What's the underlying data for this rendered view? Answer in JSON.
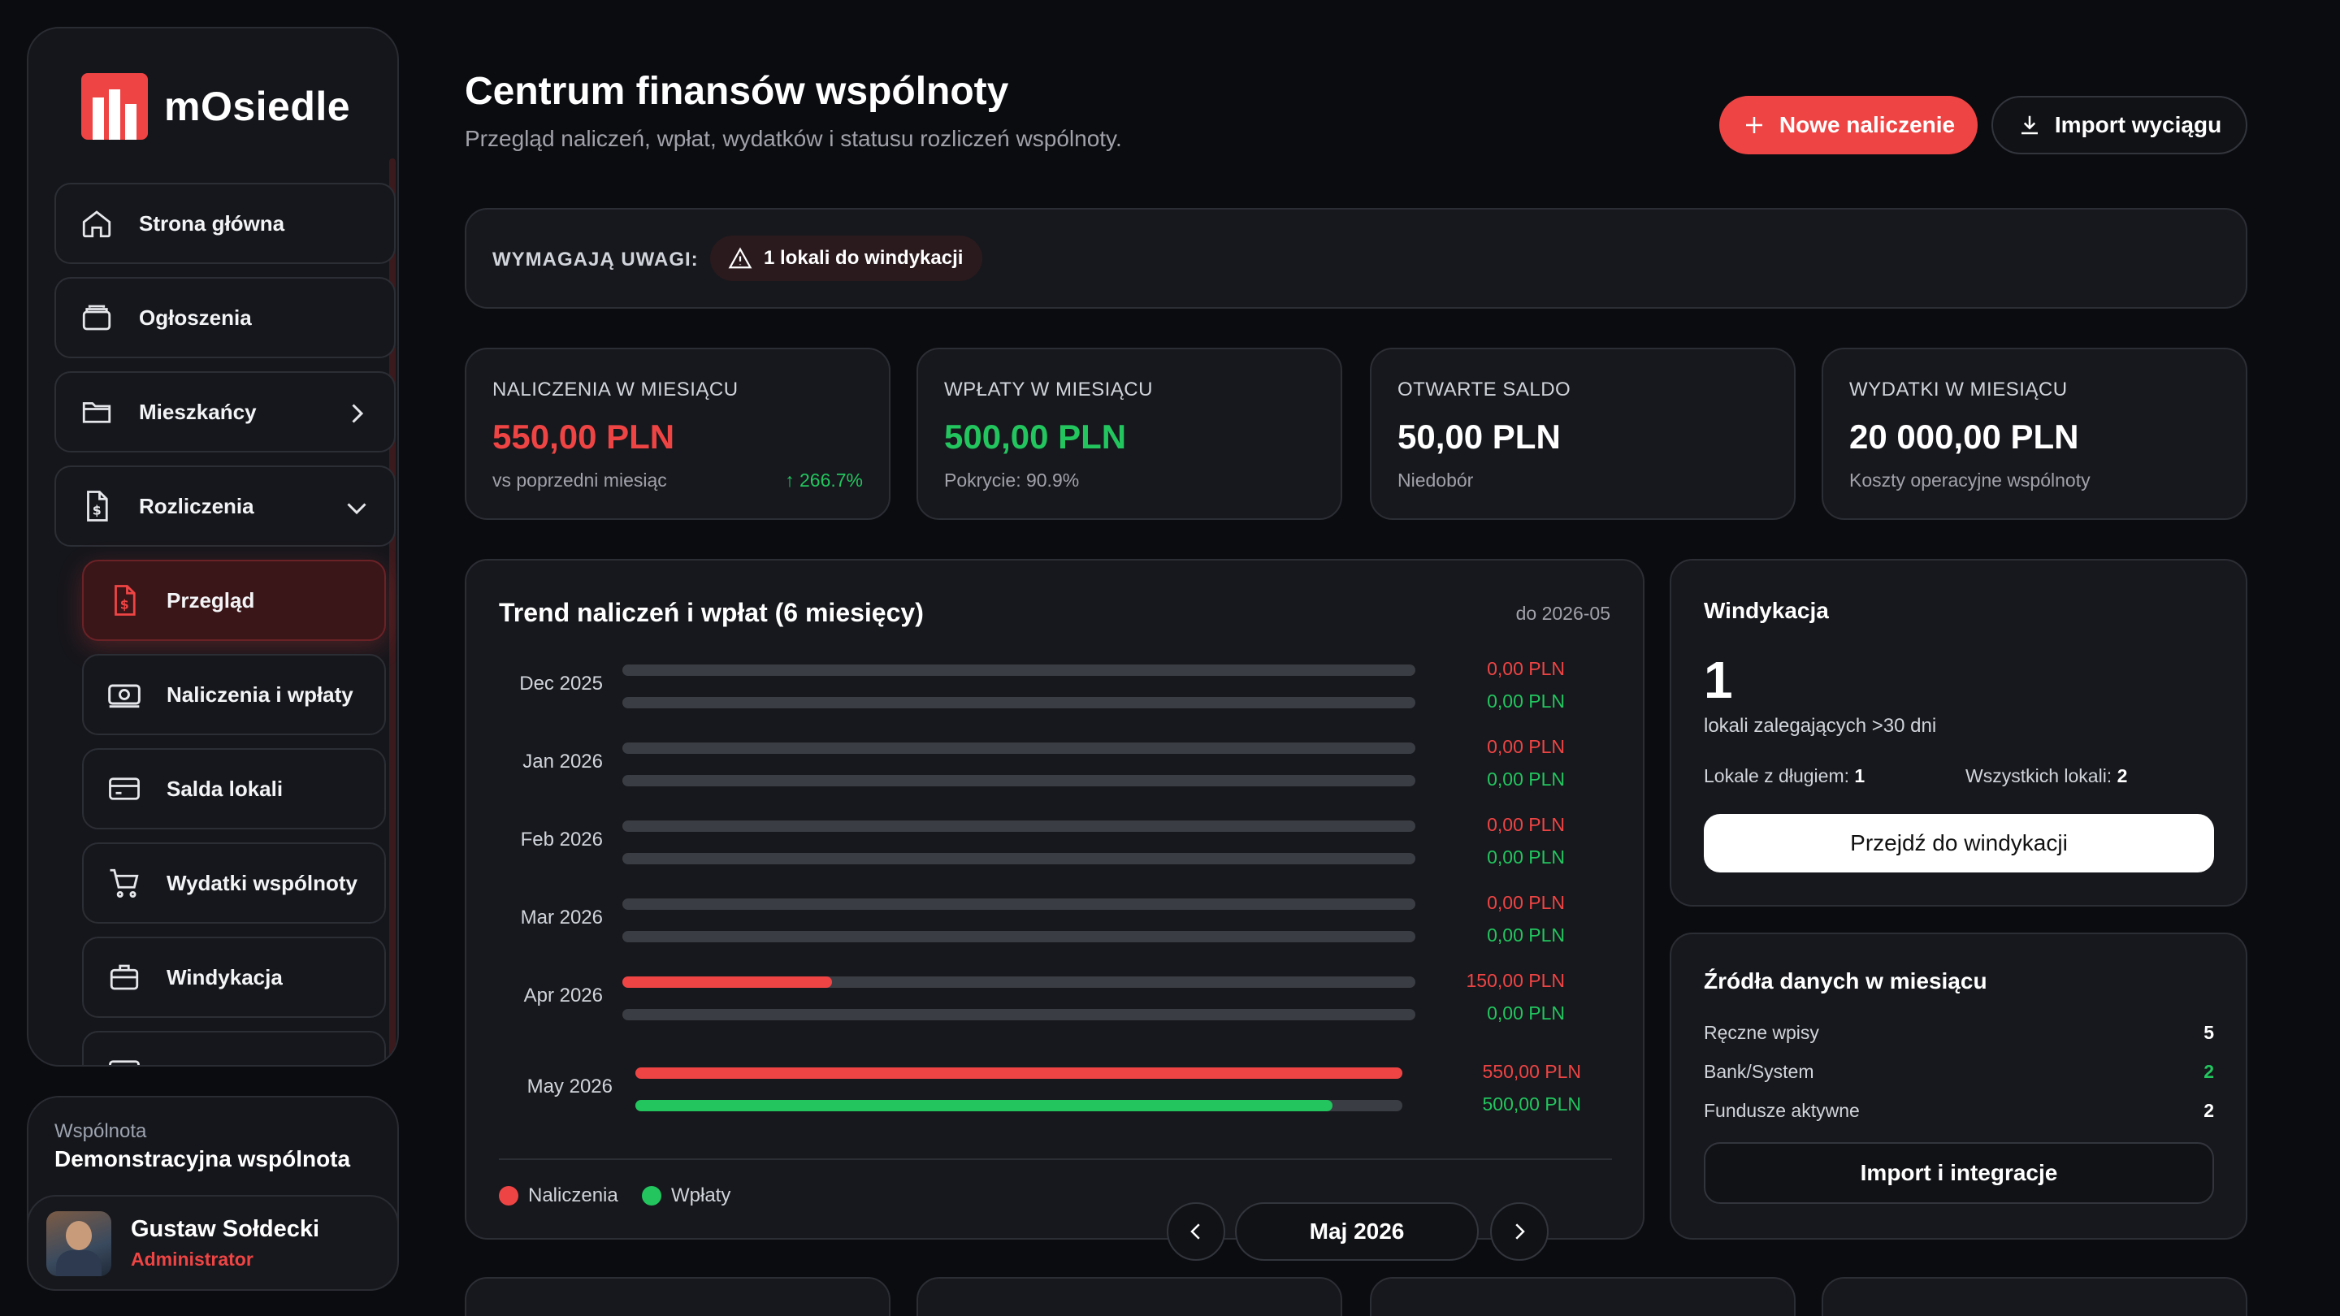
{
  "app": {
    "name": "mOsiedle",
    "brand_color": "#ef4444"
  },
  "sidebar": {
    "items": [
      {
        "label": "Strona główna",
        "icon": "home-icon"
      },
      {
        "label": "Ogłoszenia",
        "icon": "archive-icon"
      },
      {
        "label": "Mieszkańcy",
        "icon": "folder-icon"
      },
      {
        "label": "Rozliczenia",
        "icon": "invoice-icon"
      }
    ],
    "sub_items": [
      {
        "label": "Przegląd",
        "icon": "invoice-dollar-icon",
        "active": true
      },
      {
        "label": "Naliczenia i wpłaty",
        "icon": "banknote-icon"
      },
      {
        "label": "Salda lokali",
        "icon": "credit-card-icon"
      },
      {
        "label": "Wydatki wspólnoty",
        "icon": "cart-icon"
      },
      {
        "label": "Windykacja",
        "icon": "briefcase-icon"
      }
    ]
  },
  "community": {
    "label": "Wspólnota",
    "name": "Demonstracyjna wspólnota"
  },
  "user": {
    "name": "Gustaw Sołdecki",
    "role": "Administrator"
  },
  "header": {
    "title": "Centrum finansów wspólnoty",
    "subtitle": "Przegląd naliczeń, wpłat, wydatków i statusu rozliczeń wspólnoty.",
    "new_button": "Nowe naliczenie",
    "import_button": "Import wyciągu"
  },
  "alerts": {
    "label": "WYMAGAJĄ UWAGI:",
    "pill": "1 lokali do windykacji"
  },
  "stats": [
    {
      "label": "NALICZENIA W MIESIĄCU",
      "value": "550,00 PLN",
      "desc": "vs poprzedni miesiąc",
      "trend": "↑ 266.7%",
      "color": "#ef4444"
    },
    {
      "label": "WPŁATY W MIESIĄCU",
      "value": "500,00 PLN",
      "desc": "Pokrycie: 90.9%",
      "trend": "",
      "color": "#22c55e"
    },
    {
      "label": "OTWARTE SALDO",
      "value": "50,00 PLN",
      "desc": "Niedobór",
      "trend": "",
      "color": "#ffffff"
    },
    {
      "label": "WYDATKI W MIESIĄCU",
      "value": "20 000,00 PLN",
      "desc": "Koszty operacyjne wspólnoty",
      "trend": "",
      "color": "#ffffff"
    }
  ],
  "trend": {
    "title": "Trend naliczeń i wpłat (6 miesięcy)",
    "range": "do 2026-05",
    "legend": [
      "Naliczenia",
      "Wpłaty"
    ]
  },
  "chart_data": {
    "type": "bar",
    "categories": [
      "Dec 2025",
      "Jan 2026",
      "Feb 2026",
      "Mar 2026",
      "Apr 2026",
      "May 2026"
    ],
    "series": [
      {
        "name": "Naliczenia",
        "values": [
          0,
          0,
          0,
          0,
          150,
          550
        ],
        "labels": [
          "0,00 PLN",
          "0,00 PLN",
          "0,00 PLN",
          "0,00 PLN",
          "150,00 PLN",
          "550,00 PLN"
        ],
        "color": "#ef4444"
      },
      {
        "name": "Wpłaty",
        "values": [
          0,
          0,
          0,
          0,
          0,
          500
        ],
        "labels": [
          "0,00 PLN",
          "0,00 PLN",
          "0,00 PLN",
          "0,00 PLN",
          "0,00 PLN",
          "500,00 PLN"
        ],
        "color": "#22c55e"
      }
    ],
    "max": 550
  },
  "month_nav": {
    "label": "Maj 2026"
  },
  "windykacja": {
    "title": "Windykacja",
    "count": "1",
    "count_label": "lokali zalegających >30 dni",
    "debt_label": "Lokale z długiem:",
    "debt_value": "1",
    "all_label": "Wszystkich lokali:",
    "all_value": "2",
    "button": "Przejdź do windykacji"
  },
  "sources": {
    "title": "Źródła danych w miesiącu",
    "rows": [
      {
        "label": "Ręczne wpisy",
        "value": "5"
      },
      {
        "label": "Bank/System",
        "value": "2"
      },
      {
        "label": "Fundusze aktywne",
        "value": "2"
      }
    ],
    "button": "Import i integracje"
  }
}
